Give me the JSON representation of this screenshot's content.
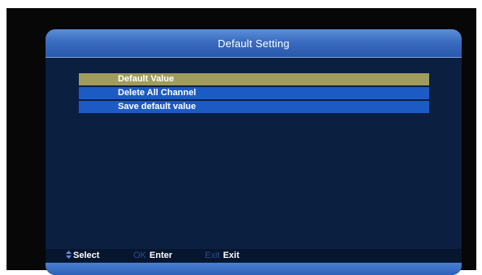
{
  "window": {
    "title": "Default Setting"
  },
  "menu": {
    "items": [
      {
        "label": "Default Value",
        "selected": true
      },
      {
        "label": "Delete All Channel",
        "selected": false
      },
      {
        "label": "Save default value",
        "selected": false
      }
    ]
  },
  "footer": {
    "select": {
      "icon": "up-down-arrow-icon",
      "label": "Select"
    },
    "ok": {
      "key": "OK",
      "label": "Enter"
    },
    "exit": {
      "key": "Exit",
      "label": "Exit"
    }
  },
  "colors": {
    "selected_item": "#a09c5c",
    "menu_item": "#1d5bc4",
    "panel_bg": "#0b1f40",
    "header": "#3a6cc0",
    "dim_key": "#2a4f8f"
  }
}
